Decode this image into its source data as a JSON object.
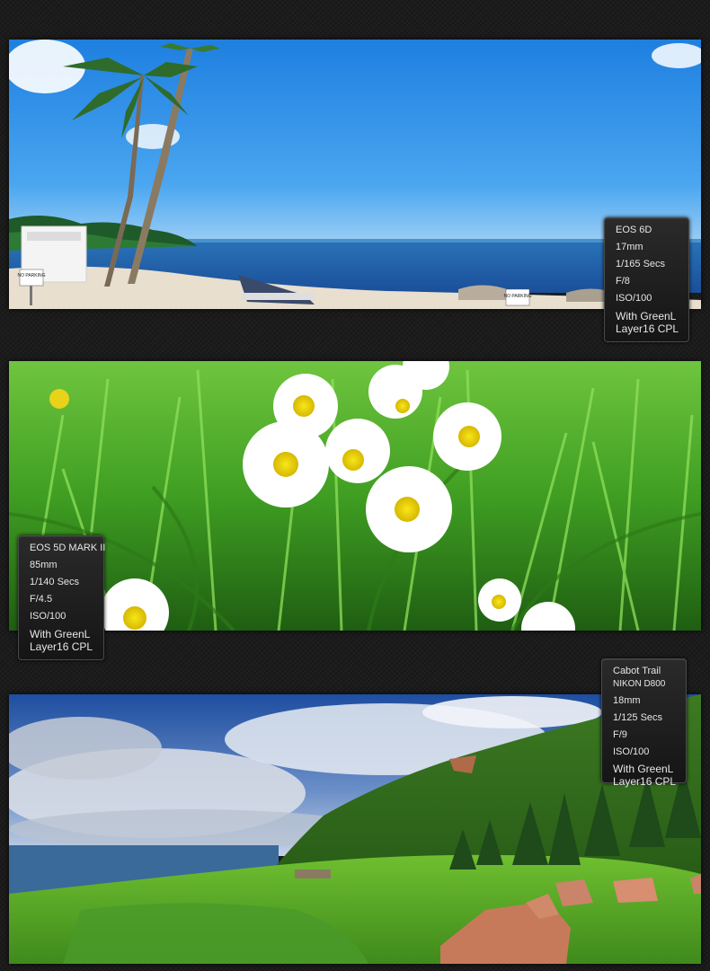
{
  "panels": [
    {
      "scene": "beach",
      "signs": [
        "NO PARKING",
        "NO PARKING"
      ],
      "info": {
        "camera": "EOS 6D",
        "focal": "17mm",
        "shutter": "1/165 Secs",
        "aperture": "F/8",
        "iso": "ISO/100",
        "filter_line1": "With GreenL",
        "filter_line2": "Layer16 CPL"
      }
    },
    {
      "scene": "daisies",
      "info": {
        "camera": "EOS 5D MARK II",
        "focal": "85mm",
        "shutter": "1/140 Secs",
        "aperture": "F/4.5",
        "iso": "ISO/100",
        "filter_line1": "With GreenL",
        "filter_line2": "Layer16 CPL"
      }
    },
    {
      "scene": "coast",
      "info": {
        "location": "Cabot Trail",
        "camera": "NIKON D800",
        "focal": "18mm",
        "shutter": "1/125 Secs",
        "aperture": "F/9",
        "iso": "ISO/100",
        "filter_line1": "With GreenL",
        "filter_line2": "Layer16 CPL"
      }
    }
  ],
  "colors": {
    "background": "#1c1c1c",
    "box_text": "#e6e6e6"
  }
}
